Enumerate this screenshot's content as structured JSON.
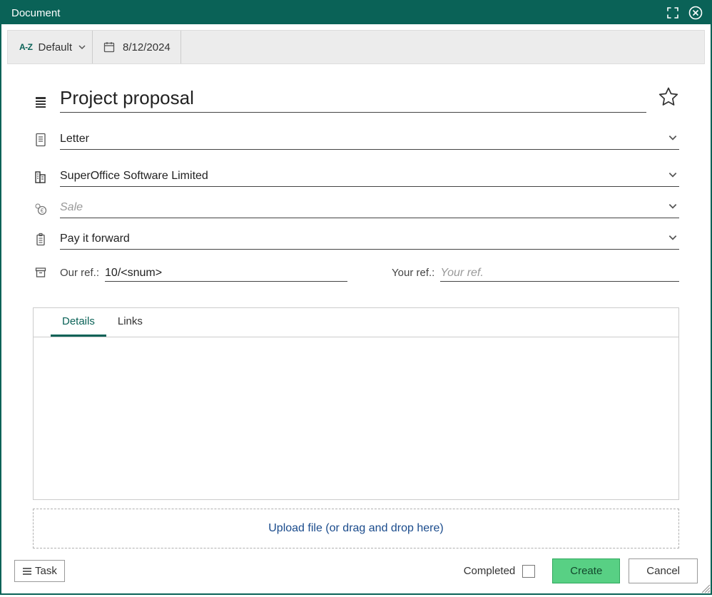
{
  "window": {
    "title": "Document"
  },
  "toolbar": {
    "language": "Default",
    "date": "8/12/2024"
  },
  "form": {
    "title": "Project proposal",
    "template": "Letter",
    "company": "SuperOffice Software Limited",
    "sale_placeholder": "Sale",
    "project": "Pay it forward",
    "our_ref_label": "Our ref.:",
    "our_ref_value": "10/<snum>",
    "your_ref_label": "Your ref.:",
    "your_ref_placeholder": "Your ref."
  },
  "tabs": [
    {
      "label": "Details",
      "active": true
    },
    {
      "label": "Links",
      "active": false
    }
  ],
  "upload": {
    "label": "Upload file (or drag and drop here)"
  },
  "footer": {
    "task": "Task",
    "completed_label": "Completed",
    "create": "Create",
    "cancel": "Cancel"
  }
}
